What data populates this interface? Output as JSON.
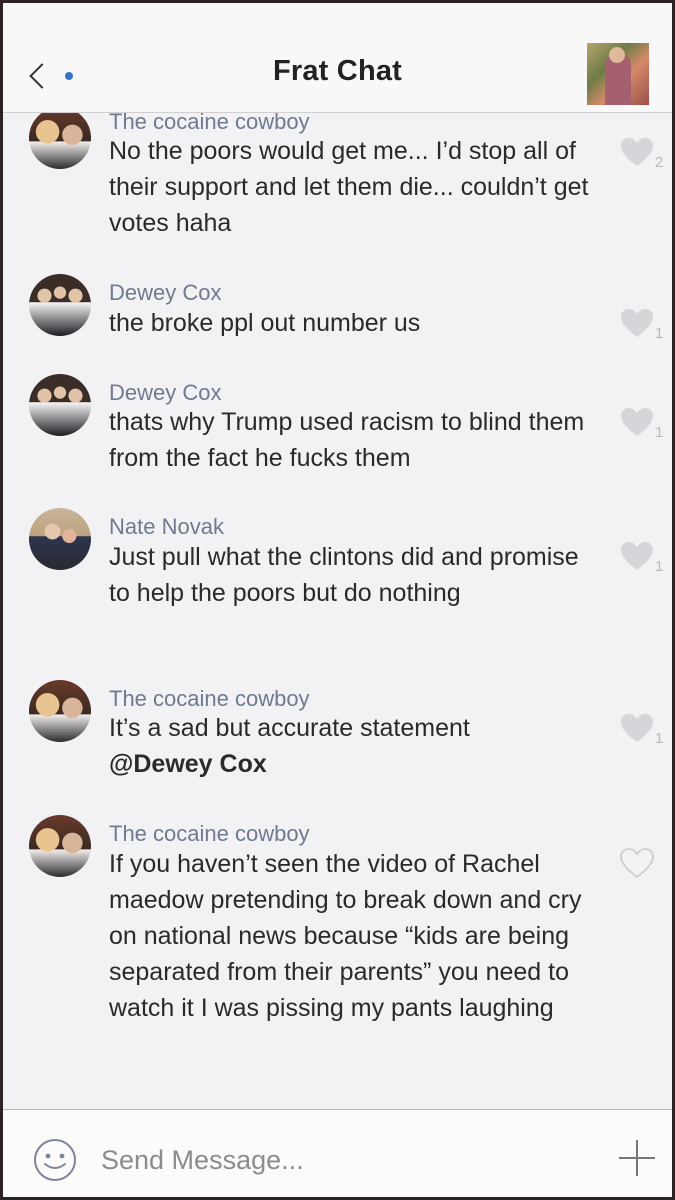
{
  "header": {
    "title": "Frat Chat"
  },
  "messages": [
    {
      "author": "The cocaine cowboy",
      "text": "No the poors would get me... I’d stop all of their support and let them die... couldn’t get votes haha",
      "likes": "2",
      "liked": true,
      "avatar": "couple"
    },
    {
      "author": "Dewey Cox",
      "text": "the broke ppl out number us",
      "likes": "1",
      "liked": true,
      "avatar": "group"
    },
    {
      "author": "Dewey Cox",
      "text": "thats why Trump used racism to blind them from the fact he fucks them",
      "likes": "1",
      "liked": true,
      "avatar": "group"
    },
    {
      "author": "Nate Novak",
      "text": "Just pull what the clintons did and promise to help the poors but do nothing",
      "likes": "1",
      "liked": true,
      "avatar": "nate"
    },
    {
      "author": "The cocaine cowboy",
      "text": "It’s a sad but accurate statement",
      "mention": "@Dewey Cox",
      "likes": "1",
      "liked": true,
      "avatar": "couple"
    },
    {
      "author": "The cocaine cowboy",
      "text": "If you haven’t seen the video of Rachel maedow pretending to break down and cry on national news because “kids are being separated from their parents” you need to watch it I was pissing my pants laughing",
      "likes": "",
      "liked": false,
      "avatar": "couple"
    }
  ],
  "composer": {
    "placeholder": "Send Message..."
  },
  "icons": {
    "back": "chevron-left-icon",
    "emoji": "smiley-icon",
    "add": "plus-icon",
    "like": "heart-icon"
  },
  "colors": {
    "accent_dot": "#3a73c4",
    "author": "#6f7a8f",
    "heart": "#d6d6da"
  }
}
